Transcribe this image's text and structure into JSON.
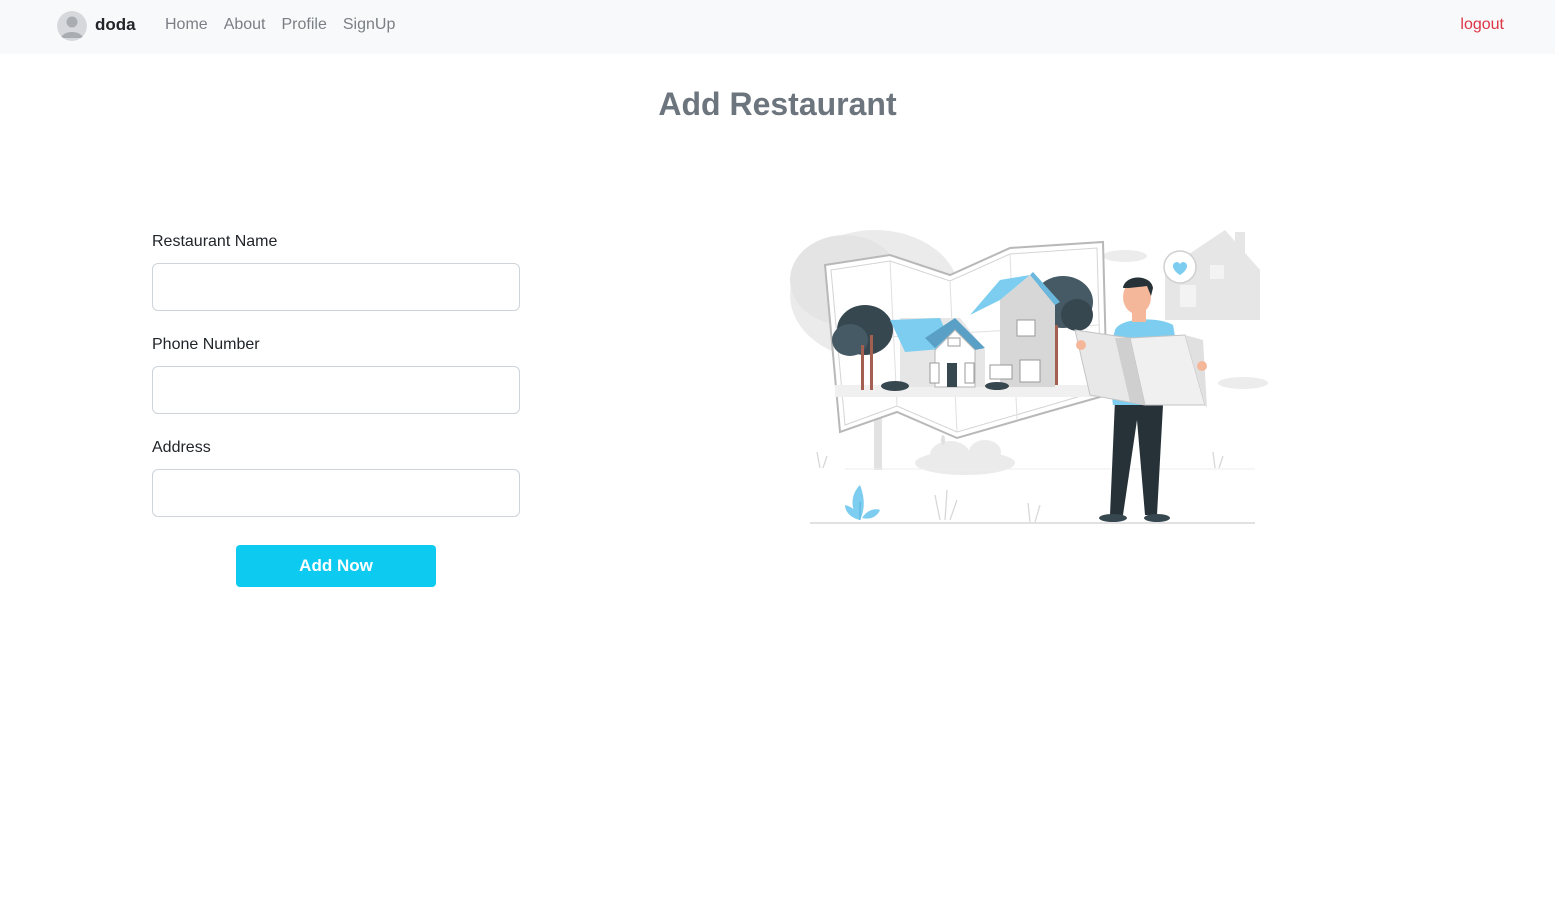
{
  "navbar": {
    "brand": "doda",
    "links": [
      "Home",
      "About",
      "Profile",
      "SignUp"
    ],
    "logout": "logout"
  },
  "page": {
    "title": "Add Restaurant"
  },
  "form": {
    "restaurant_name_label": "Restaurant Name",
    "restaurant_name_value": "",
    "phone_label": "Phone Number",
    "phone_value": "",
    "address_label": "Address",
    "address_value": "",
    "submit_label": "Add Now"
  },
  "colors": {
    "navbar_bg": "#f8f9fa",
    "logout": "#dc3545",
    "button": "#0dcaf0",
    "title": "#6c757d",
    "accent_blue": "#7ccdf0"
  },
  "icons": {
    "avatar": "user-avatar-icon",
    "illustration": "house-map-illustration"
  }
}
